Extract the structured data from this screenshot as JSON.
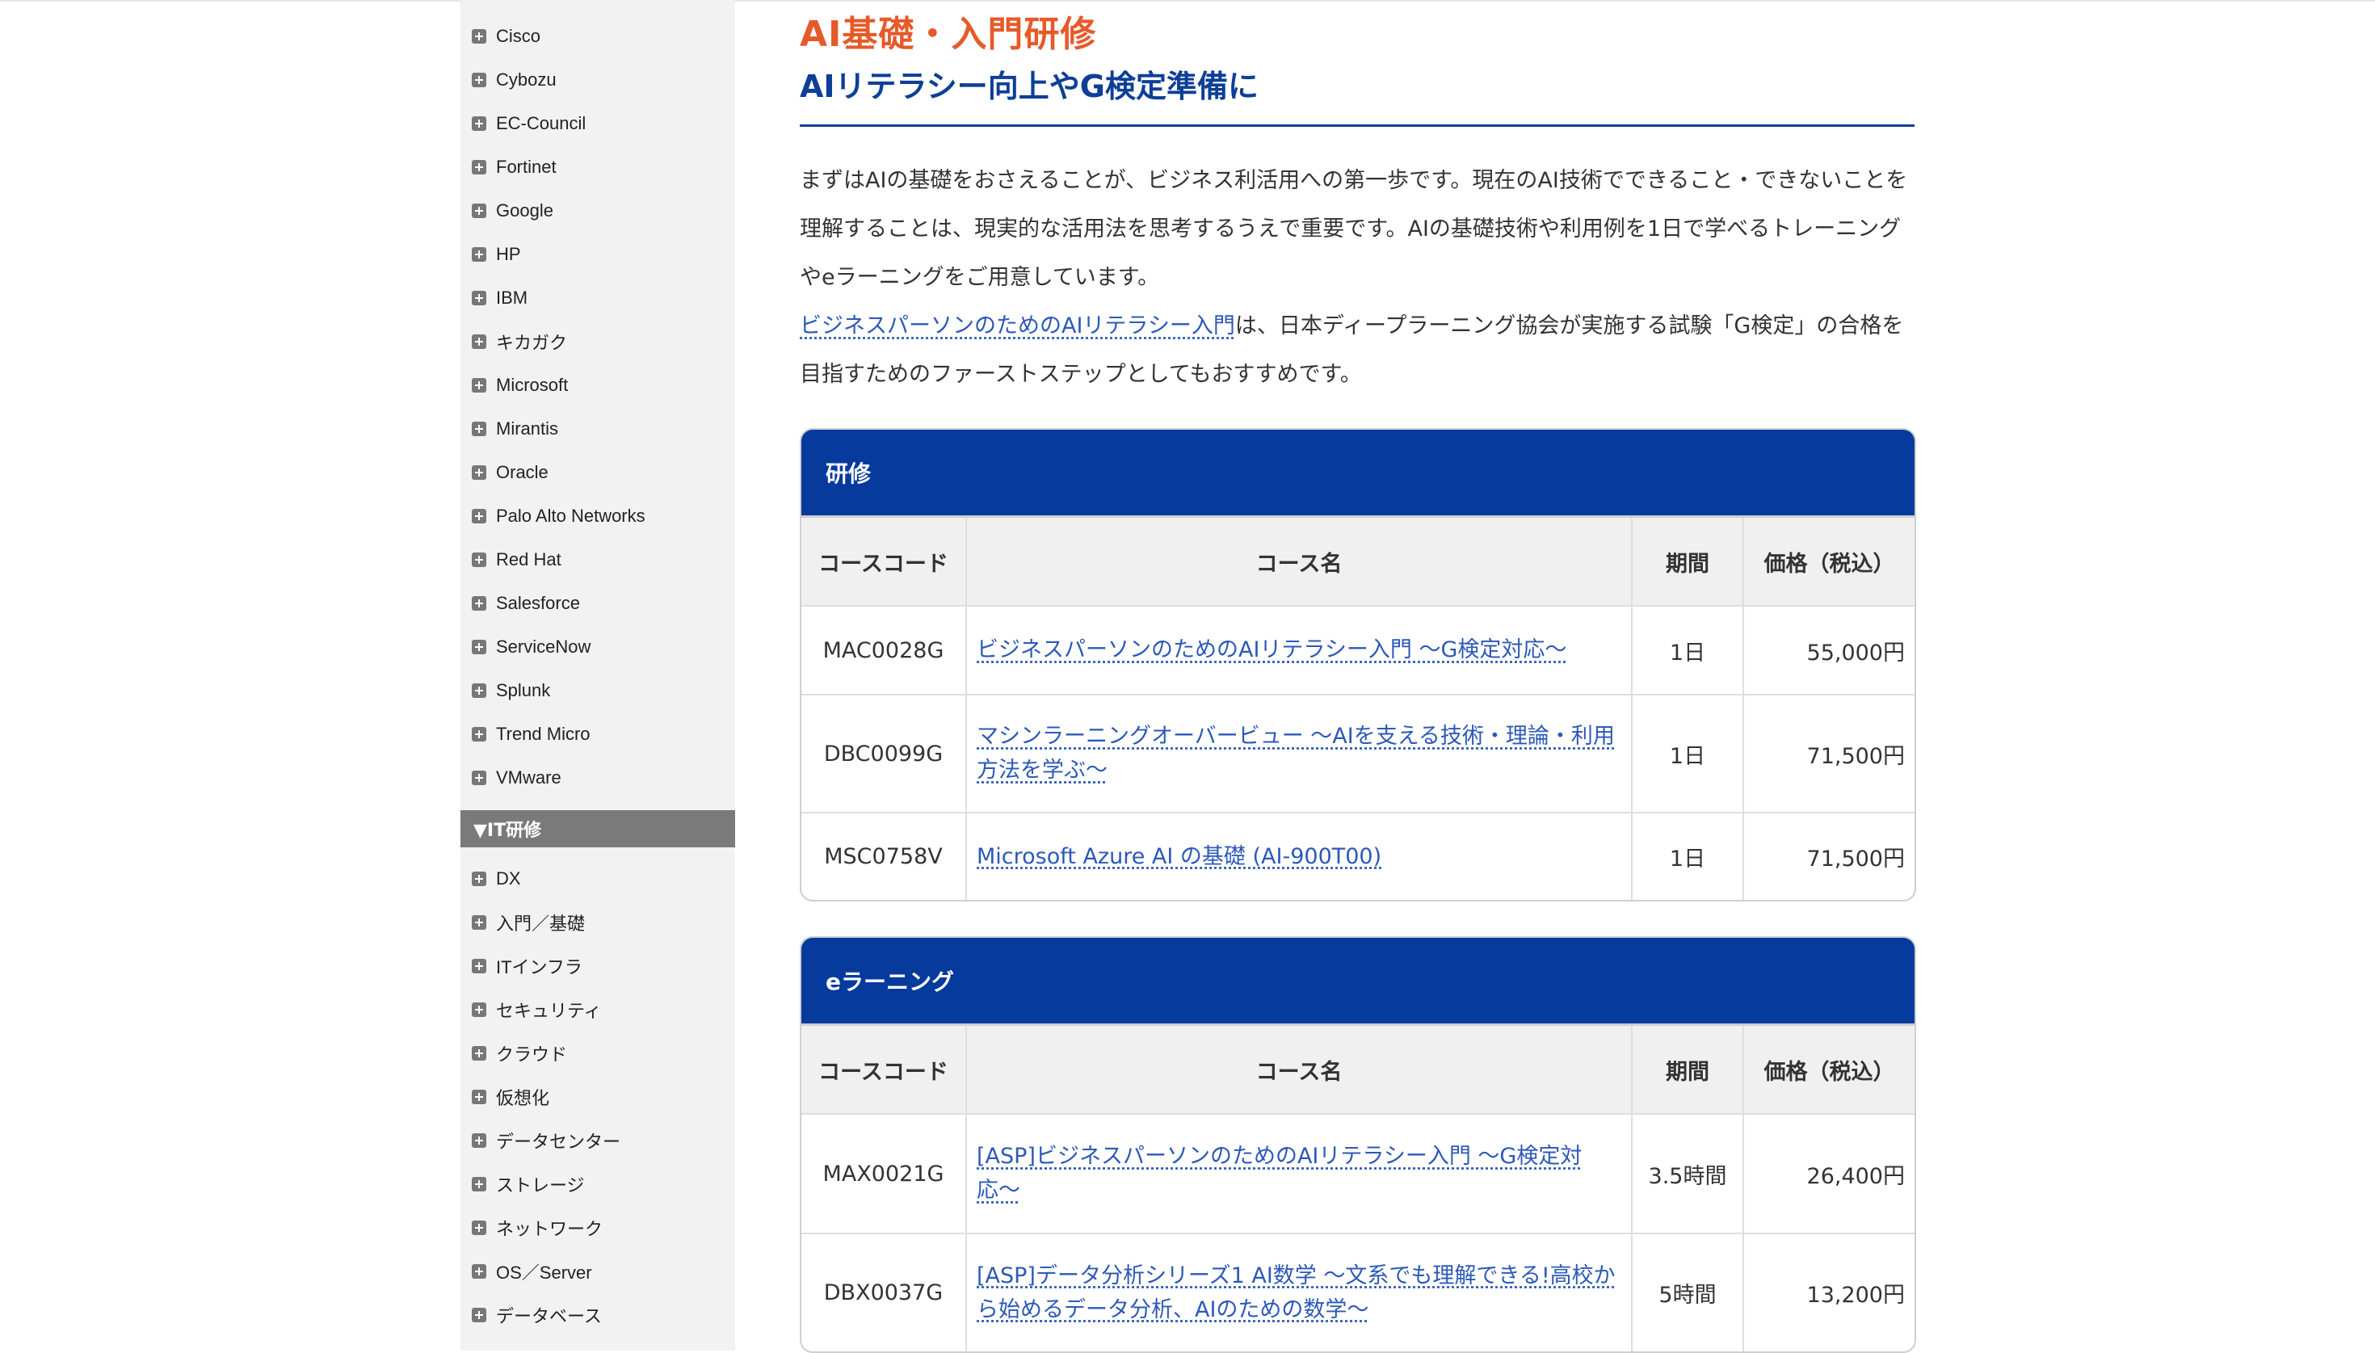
{
  "sidebar": {
    "vendors": [
      "Cisco",
      "Cybozu",
      "EC-Council",
      "Fortinet",
      "Google",
      "HP",
      "IBM",
      "キカガク",
      "Microsoft",
      "Mirantis",
      "Oracle",
      "Palo Alto Networks",
      "Red Hat",
      "Salesforce",
      "ServiceNow",
      "Splunk",
      "Trend Micro",
      "VMware"
    ],
    "section_header": "▼IT研修",
    "it_training": [
      "DX",
      "入門／基礎",
      "ITインフラ",
      "セキュリティ",
      "クラウド",
      "仮想化",
      "データセンター",
      "ストレージ",
      "ネットワーク",
      "OS／Server",
      "データベース"
    ]
  },
  "main": {
    "title": "AI基礎・入門研修",
    "subtitle": "AIリテラシー向上やG検定準備に",
    "intro": "まずはAIの基礎をおさえることが、ビジネス利活用への第一歩です。現在のAI技術でできること・できないことを理解することは、現実的な活用法を思考するうえで重要です。AIの基礎技術や利用例を1日で学べるトレーニングやeラーニングをご用意しています。",
    "intro2_link": "ビジネスパーソンのためのAIリテラシー入門",
    "intro2_rest": "は、日本ディープラーニング協会が実施する試験「G検定」の合格を目指すためのファーストステップとしてもおすすめです。",
    "columns": {
      "code": "コースコード",
      "name": "コース名",
      "duration": "期間",
      "price": "価格（税込）"
    },
    "training": {
      "header": "研修",
      "rows": [
        {
          "code": "MAC0028G",
          "name": "ビジネスパーソンのためのAIリテラシー入門 〜G検定対応〜",
          "duration": "1日",
          "price": "55,000円"
        },
        {
          "code": "DBC0099G",
          "name": "マシンラーニングオーバービュー 〜AIを支える技術・理論・利用方法を学ぶ〜",
          "duration": "1日",
          "price": "71,500円"
        },
        {
          "code": "MSC0758V",
          "name": "Microsoft Azure AI の基礎 (AI-900T00)",
          "duration": "1日",
          "price": "71,500円"
        }
      ]
    },
    "elearning": {
      "header": "eラーニング",
      "rows": [
        {
          "code": "MAX0021G",
          "name": "[ASP]ビジネスパーソンのためのAIリテラシー入門 〜G検定対応〜",
          "duration": "3.5時間",
          "price": "26,400円"
        },
        {
          "code": "DBX0037G",
          "name": "[ASP]データ分析シリーズ1 AI数学 〜文系でも理解できる!高校から始めるデータ分析、AIのための数学〜",
          "duration": "5時間",
          "price": "13,200円"
        }
      ]
    }
  }
}
